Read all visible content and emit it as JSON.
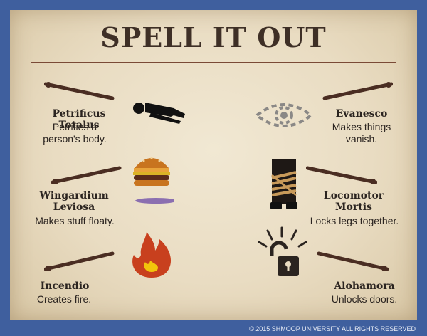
{
  "title": "SPELL IT OUT",
  "spells": [
    {
      "name": "Petrificus Totalus",
      "desc": "Petrifies a person's body.",
      "icon": "body-icon"
    },
    {
      "name": "Evanesco",
      "desc": "Makes things vanish.",
      "icon": "eye-icon"
    },
    {
      "name": "Wingardium Leviosa",
      "desc": "Makes stuff floaty.",
      "icon": "burger-icon"
    },
    {
      "name": "Locomotor Mortis",
      "desc": "Locks legs together.",
      "icon": "tied-legs-icon"
    },
    {
      "name": "Incendio",
      "desc": "Creates fire.",
      "icon": "fire-icon"
    },
    {
      "name": "Alohamora",
      "desc": "Unlocks doors.",
      "icon": "unlocked-padlock-icon"
    }
  ],
  "footer": "© 2015 SHMOOP UNIVERSITY ALL RIGHTS RESERVED",
  "colors": {
    "frame": "#3f5f9e",
    "wand": "#4a2d22",
    "burger_bun": "#c8741f",
    "fire": "#c8401e",
    "rope": "#c89a5a"
  }
}
